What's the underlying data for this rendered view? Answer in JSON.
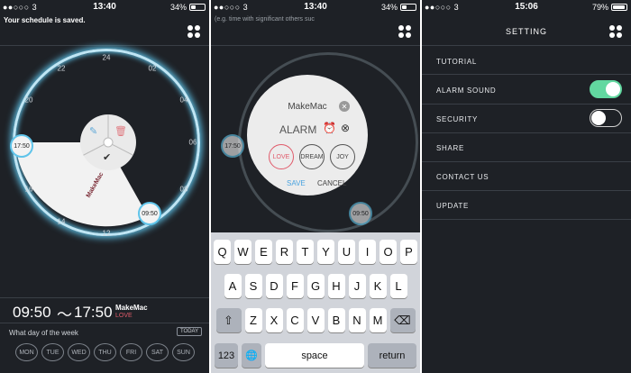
{
  "screens": [
    {
      "status": {
        "carrier": "●●○○○ 3",
        "time": "13:40",
        "battery": "34%"
      },
      "message": "Your schedule is saved.",
      "clock": {
        "hours": [
          "22",
          "24",
          "02",
          "20",
          "04",
          "18",
          "06",
          "16",
          "08",
          "14",
          "12",
          "10"
        ],
        "start_bubble": "17:50",
        "end_bubble": "09:50",
        "sector_label": "MakeMac"
      },
      "action_menu": {
        "edit_icon": "✎",
        "delete_icon": "🗑",
        "confirm_icon": "✔"
      },
      "summary": {
        "start": "09:50",
        "separator": "～",
        "end": "17:50",
        "name": "MakeMac",
        "tag": "LOVE"
      },
      "week": {
        "label": "What day of the week",
        "today": "TODAY",
        "days": [
          "MON",
          "TUE",
          "WED",
          "THU",
          "FRI",
          "SAT",
          "SUN"
        ]
      }
    },
    {
      "status": {
        "carrier": "●●○○○ 3",
        "time": "13:40",
        "battery": "34%"
      },
      "hint": "(e.g. time with significant others suc",
      "bubbles": {
        "start": "17:50",
        "end": "09:50"
      },
      "dialog": {
        "title": "MakeMac",
        "close_icon": "✕",
        "type_label": "ALARM",
        "alarm_on_icon": "⏰",
        "alarm_off_icon": "⊗",
        "tags": [
          "LOVE",
          "DREAM",
          "JOY"
        ],
        "save": "SAVE",
        "cancel": "CANCEL"
      },
      "keyboard": {
        "row1": [
          "Q",
          "W",
          "E",
          "R",
          "T",
          "Y",
          "U",
          "I",
          "O",
          "P"
        ],
        "row2": [
          "A",
          "S",
          "D",
          "F",
          "G",
          "H",
          "J",
          "K",
          "L"
        ],
        "row3": [
          "Z",
          "X",
          "C",
          "V",
          "B",
          "N",
          "M"
        ],
        "shift": "⇧",
        "delete": "⌫",
        "numbers": "123",
        "globe": "🌐",
        "space": "space",
        "return": "return"
      }
    },
    {
      "status": {
        "carrier": "●●○○○ 3",
        "time": "15:06",
        "battery": "79%"
      },
      "title": "SETTING",
      "items": [
        {
          "label": "TUTORIAL"
        },
        {
          "label": "ALARM SOUND",
          "toggle": "on"
        },
        {
          "label": "SECURITY",
          "toggle": "off"
        },
        {
          "label": "SHARE"
        },
        {
          "label": "CONTACT US"
        },
        {
          "label": "UPDATE"
        }
      ]
    }
  ],
  "colors": {
    "background": "#1e2126",
    "ring": "#5fc4ea",
    "toggle_on": "#62d8a0",
    "tag_love": "#e05a6a",
    "save": "#4aa3df"
  }
}
